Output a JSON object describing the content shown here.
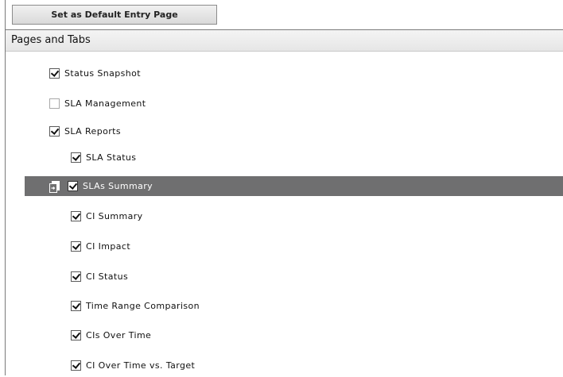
{
  "toolbar": {
    "default_label": "Set as Default Entry Page"
  },
  "panel": {
    "title": "Pages and Tabs"
  },
  "items": [
    {
      "label": "Status Snapshot",
      "checked": true
    },
    {
      "label": "SLA Management",
      "checked": false
    },
    {
      "label": "SLA Reports",
      "checked": true
    },
    {
      "label": "SLA Status",
      "checked": true
    },
    {
      "label": "SLAs Summary",
      "checked": true,
      "selected": true
    },
    {
      "label": "CI Summary",
      "checked": true
    },
    {
      "label": "CI Impact",
      "checked": true
    },
    {
      "label": "CI Status",
      "checked": true
    },
    {
      "label": "Time Range Comparison",
      "checked": true
    },
    {
      "label": "CIs Over Time",
      "checked": true
    },
    {
      "label": "CI Over Time vs. Target",
      "checked": true
    }
  ],
  "icons": {
    "selected_row_icon": "move-page-icon"
  },
  "colors": {
    "selection": "#6f6f70"
  }
}
